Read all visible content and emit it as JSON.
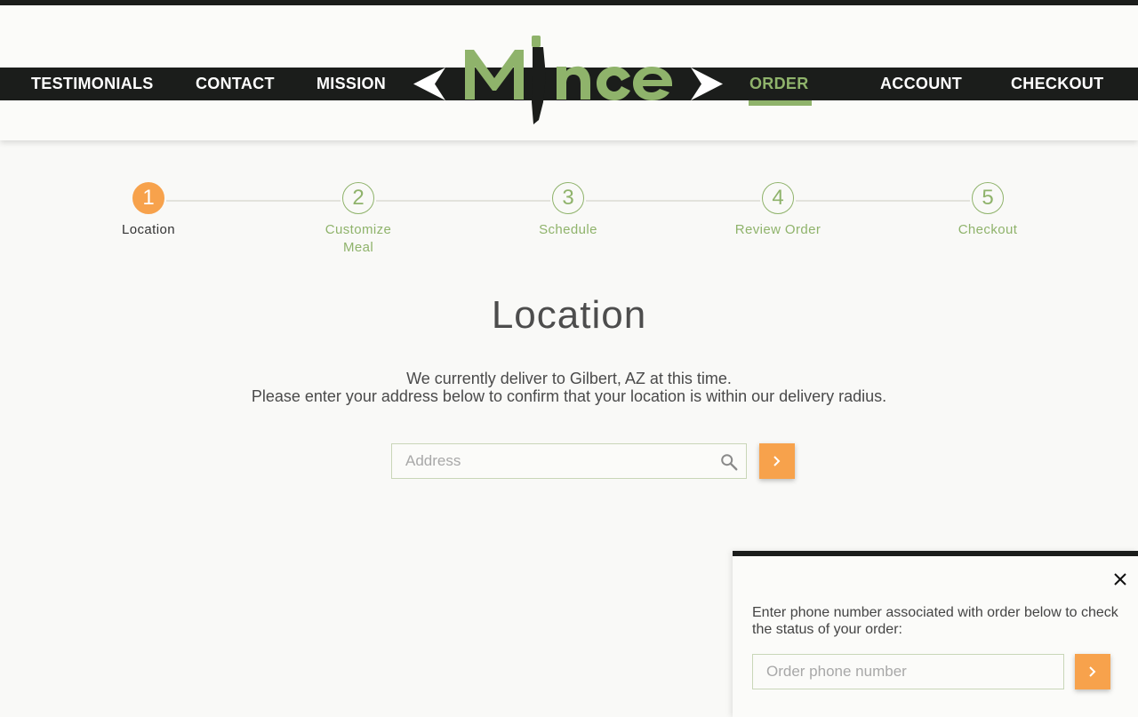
{
  "nav": {
    "left": [
      "TESTIMONIALS",
      "CONTACT",
      "MISSION"
    ],
    "right": [
      "ORDER",
      "ACCOUNT",
      "CHECKOUT"
    ],
    "active": "ORDER"
  },
  "logo": {
    "text": "Mince",
    "color": "#8fb36b"
  },
  "steps": [
    {
      "number": "1",
      "label": "Location",
      "active": true
    },
    {
      "number": "2",
      "label": "Customize Meal",
      "active": false
    },
    {
      "number": "3",
      "label": "Schedule",
      "active": false
    },
    {
      "number": "4",
      "label": "Review Order",
      "active": false
    },
    {
      "number": "5",
      "label": "Checkout",
      "active": false
    }
  ],
  "main": {
    "title": "Location",
    "line1": "We currently deliver to Gilbert, AZ at this time.",
    "line2": "Please enter your address below to confirm that your location is within our delivery radius.",
    "address_placeholder": "Address",
    "address_value": ""
  },
  "status_panel": {
    "text": "Enter phone number associated with order below to check the status of your order:",
    "phone_placeholder": "Order phone number",
    "phone_value": ""
  },
  "icons": {
    "search": "search-icon",
    "next": "chevron-right-icon",
    "close": "close-icon"
  },
  "colors": {
    "accent_green": "#8fb36b",
    "accent_orange": "#f7a24c",
    "dark_band": "#1b1d1b"
  }
}
